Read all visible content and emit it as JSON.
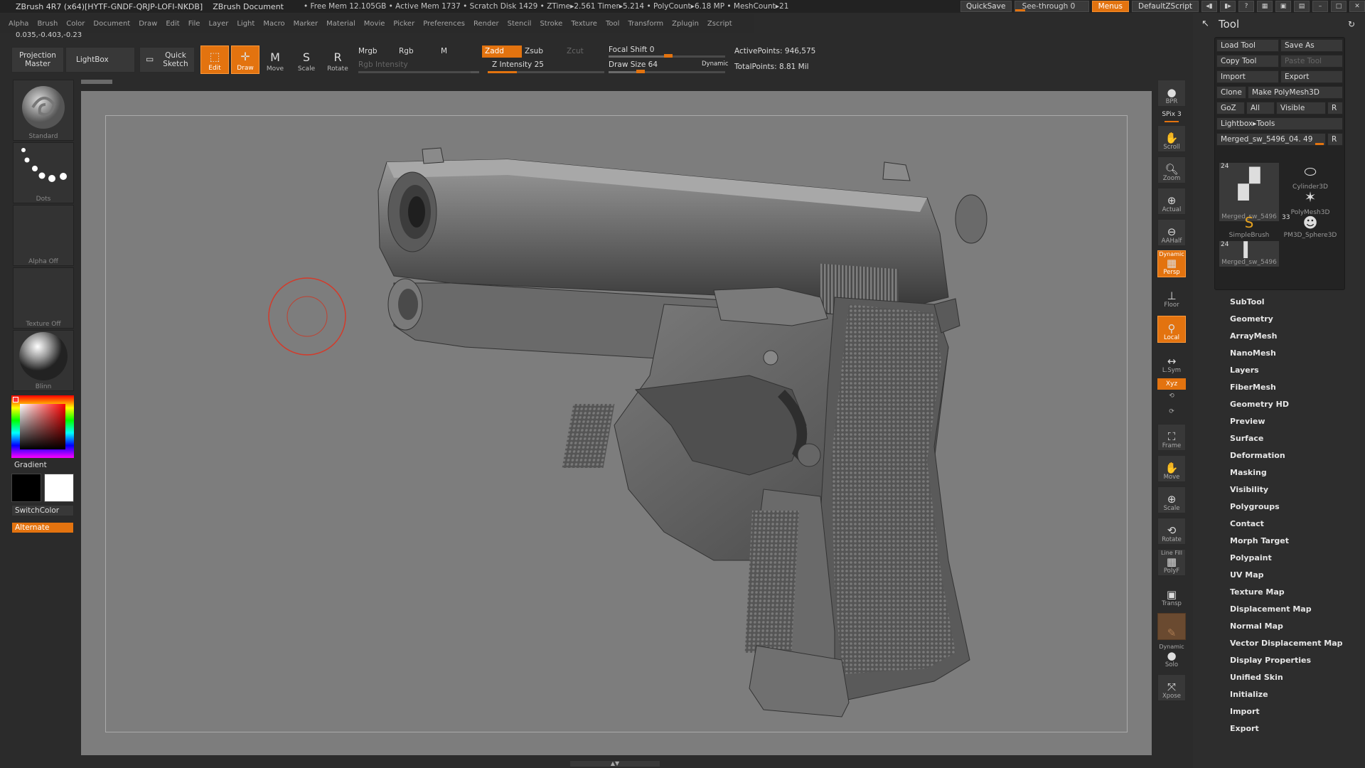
{
  "title": {
    "app": "ZBrush 4R7 (x64)[HYTF-GNDF-QRJP-LOFI-NKDB]",
    "document": "ZBrush Document",
    "stats": "• Free Mem 12.105GB • Active Mem 1737 • Scratch Disk 1429 • ZTime▸2.561 Timer▸5.214 • PolyCount▸6.18 MP • MeshCount▸21",
    "quicksave": "QuickSave",
    "seethrough": "See-through 0",
    "menus": "Menus",
    "defaultzscript": "DefaultZScript"
  },
  "menu": [
    "Alpha",
    "Brush",
    "Color",
    "Document",
    "Draw",
    "Edit",
    "File",
    "Layer",
    "Light",
    "Macro",
    "Marker",
    "Material",
    "Movie",
    "Picker",
    "Preferences",
    "Render",
    "Stencil",
    "Stroke",
    "Texture",
    "Tool",
    "Transform",
    "Zplugin",
    "Zscript"
  ],
  "coords": "0.035,-0.403,-0.23",
  "shelf": {
    "projection_master": "Projection Master",
    "lightbox": "LightBox",
    "quick_sketch": "Quick Sketch",
    "edit": "Edit",
    "draw": "Draw",
    "move": "Move",
    "scale": "Scale",
    "rotate": "Rotate",
    "mrgb": "Mrgb",
    "rgb": "Rgb",
    "m": "M",
    "rgb_intensity": "Rgb Intensity",
    "zadd": "Zadd",
    "zsub": "Zsub",
    "zcut": "Zcut",
    "z_intensity": "Z Intensity 25",
    "focal_shift": "Focal Shift 0",
    "draw_size": "Draw Size 64",
    "dynamic": "Dynamic",
    "active_points": "ActivePoints: 946,575",
    "total_points": "TotalPoints: 8.81 Mil"
  },
  "left": {
    "standard": "Standard",
    "dots": "Dots",
    "alpha": "Alpha Off",
    "texture": "Texture Off",
    "material": "Blinn",
    "gradient": "Gradient",
    "switchcolor": "SwitchColor",
    "alternate": "Alternate"
  },
  "right": {
    "bpr": "BPR",
    "spix": "SPix 3",
    "scroll": "Scroll",
    "zoom": "Zoom",
    "actual": "Actual",
    "aahalf": "AAHalf",
    "dynamic": "Dynamic",
    "persp": "Persp",
    "floor": "Floor",
    "local": "Local",
    "lsym": "L.Sym",
    "xyz": "Xyz",
    "frame": "Frame",
    "move": "Move",
    "scale": "Scale",
    "rotate": "Rotate",
    "linefill": "Line Fill",
    "polyf": "PolyF",
    "transp": "Transp",
    "ghost": "Ghost",
    "dynamic2": "Dynamic",
    "solo": "Solo",
    "xpose": "Xpose"
  },
  "tool": {
    "header": "Tool",
    "load_tool": "Load Tool",
    "save_as": "Save As",
    "copy_tool": "Copy Tool",
    "paste_tool": "Paste Tool",
    "import": "Import",
    "export": "Export",
    "clone": "Clone",
    "make_polymesh": "Make PolyMesh3D",
    "goz": "GoZ",
    "all": "All",
    "visible": "Visible",
    "r": "R",
    "lightbox_tools": "Lightbox▸Tools",
    "current_tool": "Merged_sw_5496_04. 49",
    "thumbs": [
      {
        "label": "Merged_sw_5496",
        "count": "24"
      },
      {
        "label": "Cylinder3D",
        "count": ""
      },
      {
        "label": "PolyMesh3D",
        "count": ""
      },
      {
        "label": "SimpleBrush",
        "count": ""
      },
      {
        "label": "PM3D_Sphere3D",
        "count": "33"
      },
      {
        "label": "Merged_sw_5496",
        "count": "24"
      }
    ],
    "subpalettes": [
      "SubTool",
      "Geometry",
      "ArrayMesh",
      "NanoMesh",
      "Layers",
      "FiberMesh",
      "Geometry HD",
      "Preview",
      "Surface",
      "Deformation",
      "Masking",
      "Visibility",
      "Polygroups",
      "Contact",
      "Morph Target",
      "Polypaint",
      "UV Map",
      "Texture Map",
      "Displacement Map",
      "Normal Map",
      "Vector Displacement Map",
      "Display Properties",
      "Unified Skin",
      "Initialize",
      "Import",
      "Export"
    ]
  },
  "colors": {
    "accent": "#e3730f",
    "canvas": "#7d7d7d",
    "brush_ring": "#d43a2a"
  },
  "sliders": {
    "z_intensity_fraction": 0.25,
    "focal_shift_fraction": 0.5,
    "draw_size_fraction": 0.3
  }
}
